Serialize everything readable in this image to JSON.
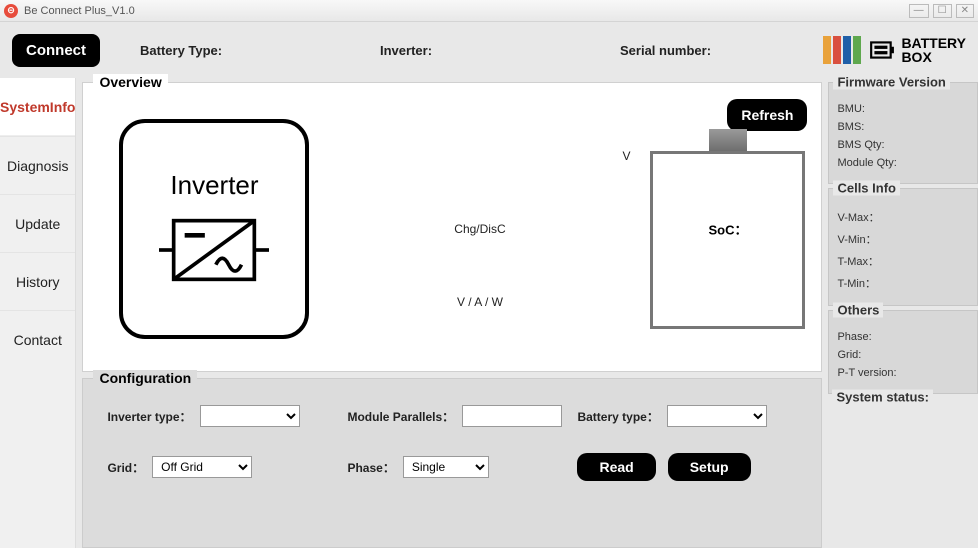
{
  "window": {
    "title": "Be Connect Plus_V1.0"
  },
  "topbar": {
    "connect": "Connect",
    "battery_type_label": "Battery Type:",
    "battery_type_value": "",
    "inverter_label": "Inverter:",
    "inverter_value": "",
    "serial_label": "Serial number:",
    "serial_value": "",
    "logo_text1": "BATTERY",
    "logo_text2": "BOX"
  },
  "sidebar": {
    "items": [
      {
        "label": "SystemInfo"
      },
      {
        "label": "Diagnosis"
      },
      {
        "label": "Update"
      },
      {
        "label": "History"
      },
      {
        "label": "Contact"
      }
    ]
  },
  "overview": {
    "title": "Overview",
    "inverter_label": "Inverter",
    "v_label": "V",
    "chg_label": "Chg/DisC",
    "vaw_label": "V / A / W",
    "soc_label": "SoC：",
    "refresh": "Refresh"
  },
  "config": {
    "title": "Configuration",
    "inverter_type_label": "Inverter type：",
    "module_parallels_label": "Module Parallels：",
    "module_parallels_value": "",
    "battery_type_label": "Battery type：",
    "grid_label": "Grid：",
    "grid_value": "Off Grid",
    "phase_label": "Phase：",
    "phase_value": "Single",
    "read": "Read",
    "setup": "Setup"
  },
  "firmware": {
    "title": "Firmware Version",
    "bmu": "BMU:",
    "bms": "BMS:",
    "bms_qty": "BMS Qty:",
    "module_qty": "Module Qty:"
  },
  "cells": {
    "title": "Cells Info",
    "vmax": "V-Max：",
    "vmin": "V-Min：",
    "tmax": "T-Max：",
    "tmin": "T-Min："
  },
  "others": {
    "title": "Others",
    "phase": "Phase:",
    "grid": "Grid:",
    "pt": "P-T version:"
  },
  "status": {
    "title": "System status:"
  }
}
